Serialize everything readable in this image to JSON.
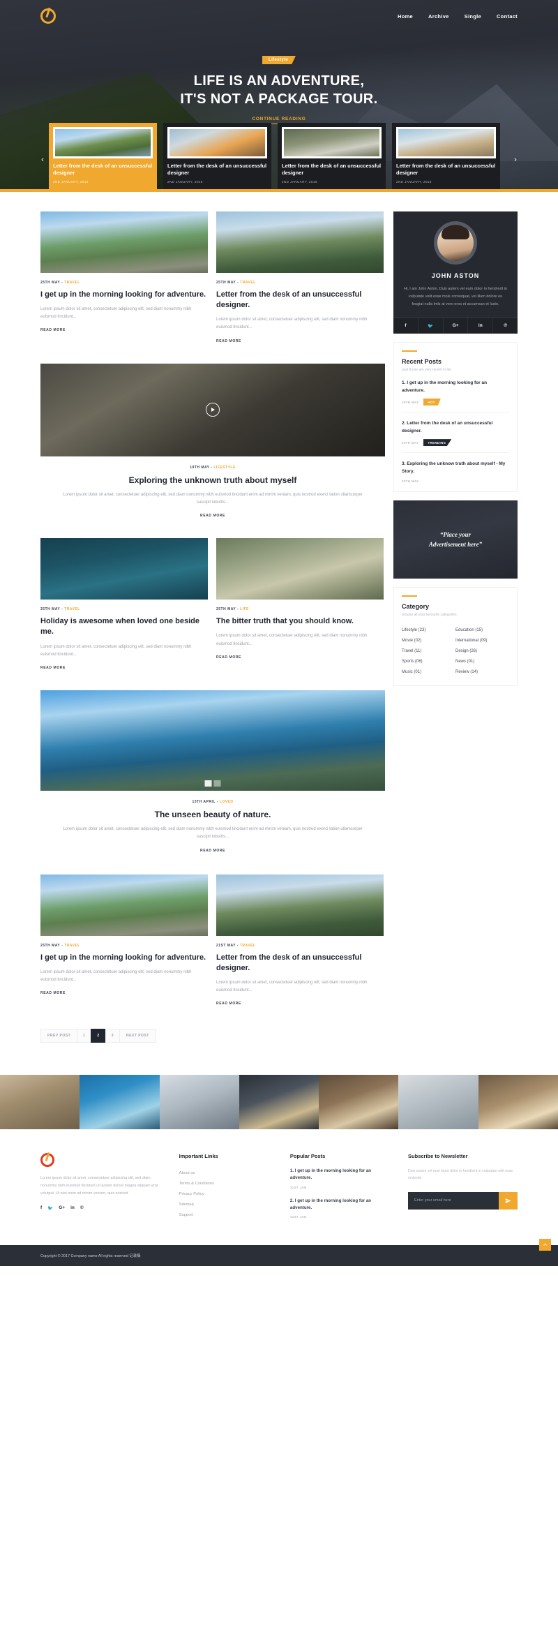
{
  "header": {
    "logo_name": "logo-icon",
    "nav": [
      {
        "label": "Home"
      },
      {
        "label": "Archive"
      },
      {
        "label": "Single"
      },
      {
        "label": "Contact"
      }
    ]
  },
  "hero": {
    "badge": "Lifestyle",
    "title_line1": "LIFE IS AN ADVENTURE,",
    "title_line2": "IT'S NOT A PACKAGE TOUR.",
    "cta": "CONTINUE READING",
    "prev_arrow": "‹",
    "next_arrow": "›"
  },
  "carousel": [
    {
      "title": "Letter from the desk of an unsuccessful designer",
      "date": "2ND JANUARY, 2016",
      "active": true
    },
    {
      "title": "Letter from the desk of an unsuccessful designer",
      "date": "2ND JANUARY, 2016",
      "active": false
    },
    {
      "title": "Letter from the desk of an unsuccessful designer",
      "date": "2ND JANUARY, 2016",
      "active": false
    },
    {
      "title": "Letter from the desk of an unsuccessful designer",
      "date": "2ND JANUARY, 2016",
      "active": false
    }
  ],
  "posts_row1": [
    {
      "date": "25TH MAY",
      "category": "TRAVEL",
      "title": "I get up in the morning looking for adventure.",
      "excerpt": "Lorem ipsum dolor sit amet, consectetuer adipiscing elit, sed diam nonummy nibh euismod tincidunt...",
      "more": "READ MORE"
    },
    {
      "date": "25TH MAY",
      "category": "TRAVEL",
      "title": "Letter from the desk of an unsuccessful designer.",
      "excerpt": "Lorem ipsum dolor sit amet, consectetuer adipiscing elit, sed diam nonummy nibh euismod tincidunt...",
      "more": "READ MORE"
    }
  ],
  "video_post": {
    "date": "19TH MAY",
    "category": "LIFESTYLE",
    "title": "Exploring the unknown truth about myself",
    "excerpt": "Lorem ipsum dolor sit amet, consectetuer adipiscing elit, sed diam nonummy nibh euismod tincidunt enim ad minim veniam, quis nostrud exerci tation ullamcorper suscipit lobortis...",
    "more": "READ MORE",
    "play_icon": "play-icon"
  },
  "posts_row2": [
    {
      "date": "25TH MAY",
      "category": "TRAVEL",
      "title": "Holiday is awesome when loved one beside me.",
      "excerpt": "Lorem ipsum dolor sit amet, consectetuer adipiscing elit, sed diam nonummy nibh euismod tincidunt...",
      "more": "READ MORE"
    },
    {
      "date": "25TH MAY",
      "category": "LIFE",
      "title": "The bitter truth that you should know.",
      "excerpt": "Lorem ipsum dolor sit amet, consectetuer adipiscing elit, sed diam nonummy nibh euismod tincidunt...",
      "more": "READ MORE"
    }
  ],
  "slider_post": {
    "date": "13TH APRIL",
    "category": "LOVED",
    "title": "The unseen beauty of nature.",
    "excerpt": "Lorem ipsum dolor sit amet, consectetuer adipiscing elit, sed diam nonummy nibh euismod tincidunt enim ad minim veniam, quis nostrud exerci tation ullamcorper suscipit lobortis...",
    "more": "READ MORE"
  },
  "posts_row3": [
    {
      "date": "25TH MAY",
      "category": "TRAVEL",
      "title": "I get up in the morning looking for adventure.",
      "excerpt": "Lorem ipsum dolor sit amet, consectetuer adipiscing elit, sed diam nonummy nibh euismod tincidunt...",
      "more": "READ MORE"
    },
    {
      "date": "21ST MAY",
      "category": "TRAVEL",
      "title": "Letter from the desk of an unsuccessful designer.",
      "excerpt": "Lorem ipsum dolor sit amet, consectetuer adipiscing elit, sed diam nonummy nibh euismod tincidunt...",
      "more": "READ MORE"
    }
  ],
  "pagination": {
    "prev": "PREV POST",
    "next": "NEXT POST",
    "pages": [
      "1",
      "2",
      "3"
    ],
    "active": "2"
  },
  "sidebar": {
    "author": {
      "name": "JOHN ASTON",
      "bio": "Hi, I am John Aston. Duis autem vel eum dolor in hendrerit in vulputate velit esse mole consequat, vel illum dolore eu feugiat nulla lmls at vero eros et accumsan et lusto.",
      "social": [
        {
          "icon": "facebook-icon",
          "glyph": "f"
        },
        {
          "icon": "twitter-icon",
          "glyph": "🐦"
        },
        {
          "icon": "google-plus-icon",
          "glyph": "G+"
        },
        {
          "icon": "linkedin-icon",
          "glyph": "in"
        },
        {
          "icon": "pinterest-icon",
          "glyph": "℗"
        }
      ]
    },
    "recent_posts": {
      "title": "Recent Posts",
      "subtitle": "post those are very recent in list",
      "items": [
        {
          "title": "1. I get up in the morning looking for an adventure.",
          "date": "25TH MAY",
          "badge": "HOT",
          "badge_style": "hot"
        },
        {
          "title": "2. Letter from the desk of an unsuccessful designer.",
          "date": "25TH MAY",
          "badge": "TRENDING",
          "badge_style": "dark"
        },
        {
          "title": "3. Exploring the unknow truth about myself - My Story.",
          "date": "25TH MAY",
          "badge": "",
          "badge_style": ""
        }
      ]
    },
    "advertisement": {
      "text_line1": "“Place your",
      "text_line2": "Advertisement here”"
    },
    "category": {
      "title": "Category",
      "subtitle": "browse all your favourite categories",
      "items": [
        {
          "label": "Lifestyle (23)"
        },
        {
          "label": "Education (15)"
        },
        {
          "label": "Movie (02)"
        },
        {
          "label": "International (09)"
        },
        {
          "label": "Travel (11)"
        },
        {
          "label": "Design (26)"
        },
        {
          "label": "Sports (06)"
        },
        {
          "label": "News (01)"
        },
        {
          "label": "Music (01)"
        },
        {
          "label": "Review (14)"
        }
      ]
    }
  },
  "footer": {
    "brand": {
      "logo_name": "footer-logo-icon",
      "text": "Lorem ipsum dolor sit amet, consectetuer adipiscing elit, sed diam nonummy nibh euismod tincidunt ut laoreet dolore magna aliquam erat volutpat. Ut wisi enim ad minim veniam, quis nostrud",
      "social": [
        {
          "icon": "facebook-icon",
          "glyph": "f"
        },
        {
          "icon": "twitter-icon",
          "glyph": "🐦"
        },
        {
          "icon": "google-plus-icon",
          "glyph": "G+"
        },
        {
          "icon": "linkedin-icon",
          "glyph": "in"
        },
        {
          "icon": "pinterest-icon",
          "glyph": "℗"
        }
      ]
    },
    "links": {
      "title": "Important Links",
      "items": [
        {
          "label": "About us"
        },
        {
          "label": "Terms & Conditions"
        },
        {
          "label": "Privacy Policy"
        },
        {
          "label": "Sitemap"
        },
        {
          "label": "Support"
        }
      ]
    },
    "popular": {
      "title": "Popular Posts",
      "items": [
        {
          "title": "1. I get up in the morning looking for an adventure.",
          "date": "31ST JAN"
        },
        {
          "title": "2. I get up in the morning looking for an adventure.",
          "date": "31ST JAN"
        }
      ]
    },
    "newsletter": {
      "title": "Subscribe to Newsletter",
      "text": "Duis autem vel eum iriure dolor in hendrerit in vulputate velit esse molestie",
      "placeholder": "Enter your email here",
      "submit_icon": "send-icon"
    }
  },
  "copyright": {
    "text": "Copyright © 2017 Company name All rights reserved 记录集",
    "to_top_icon": "chevron-up-icon"
  },
  "colors": {
    "accent": "#f0a92e",
    "dark": "#2b2f38",
    "darker": "#22262f"
  }
}
